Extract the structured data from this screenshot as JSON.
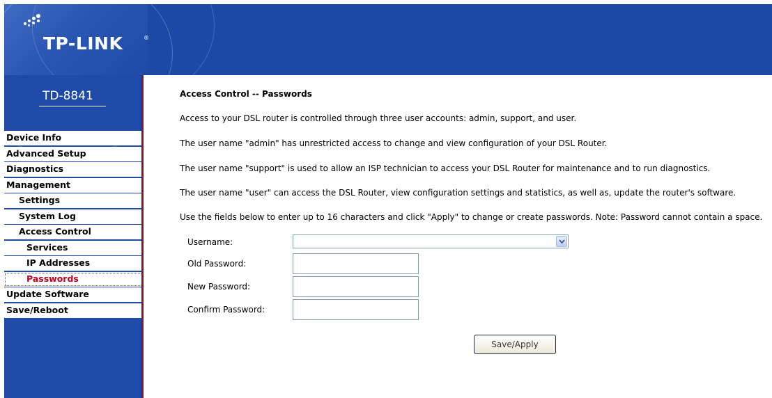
{
  "brand": {
    "logo_text": "TP-LINK",
    "registered_mark": "®",
    "model": "TD-8841"
  },
  "colors": {
    "header_blue": "#1c48a6",
    "sidebar_blue": "#1f4aa8",
    "menu_border": "#7a1a2c",
    "active_item": "#c00020"
  },
  "sidebar": {
    "items": [
      {
        "label": "Device Info",
        "level": 0
      },
      {
        "label": "Advanced Setup",
        "level": 0
      },
      {
        "label": "Diagnostics",
        "level": 0
      },
      {
        "label": "Management",
        "level": 0
      },
      {
        "label": "Settings",
        "level": 1
      },
      {
        "label": "System Log",
        "level": 1
      },
      {
        "label": "Access Control",
        "level": 1
      },
      {
        "label": "Services",
        "level": 2
      },
      {
        "label": "IP Addresses",
        "level": 2
      },
      {
        "label": "Passwords",
        "level": 2,
        "active": true
      },
      {
        "label": "Update Software",
        "level": 0
      },
      {
        "label": "Save/Reboot",
        "level": 0
      }
    ]
  },
  "main": {
    "title": "Access Control -- Passwords",
    "paragraphs": [
      "Access to your DSL router is controlled through three user accounts: admin, support, and user.",
      "The user name \"admin\" has unrestricted access to change and view configuration of your DSL Router.",
      "The user name \"support\" is used to allow an ISP technician to access your DSL Router for maintenance and to run diagnostics.",
      "The user name \"user\" can access the DSL Router, view configuration settings and statistics, as well as, update the router's software.",
      "Use the fields below to enter up to 16 characters and click \"Apply\" to change or create passwords. Note: Password cannot contain a space."
    ],
    "form": {
      "username_label": "Username:",
      "username_value": "",
      "old_password_label": "Old Password:",
      "new_password_label": "New Password:",
      "confirm_password_label": "Confirm Password:",
      "apply_label": "Save/Apply"
    }
  }
}
